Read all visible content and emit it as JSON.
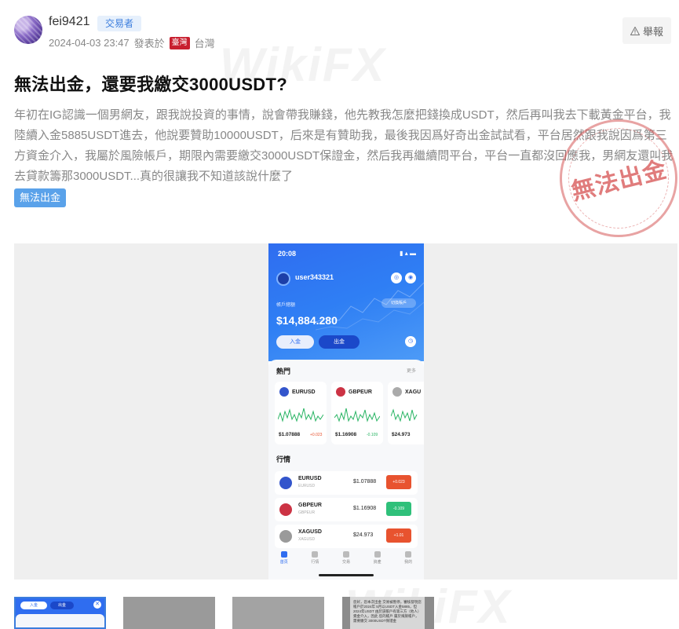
{
  "author": {
    "username": "fei9421",
    "role": "交易者",
    "datetime": "2024-04-03 23:47",
    "posted_in": "發表於",
    "flag_label": "臺灣",
    "region": "台灣"
  },
  "report": {
    "label": "舉報",
    "icon": "warning-icon"
  },
  "post": {
    "title": "無法出金，還要我繳交3000USDT?",
    "body": "年初在IG認識一個男網友，跟我說投資的事情，說會帶我賺錢，他先教我怎麼把錢換成USDT，然后再叫我去下載黃金平台，我陸續入金5885USDT進去，他說要贊助10000USDT，后來是有贊助我，最後我因爲好奇出金試試看，平台居然跟我說因爲第三方資金介入，我屬於風險帳戶，期限內需要繳交3000USDT保證金，然后我再繼續問平台，平台一直都沒回應我，男網友還叫我去貸款籌那3000USDT...真的很讓我不知道該說什麼了",
    "tag": "無法出金",
    "stamp": "無法出金",
    "watermark": "WikiFX"
  },
  "phone": {
    "time": "20:08",
    "status_icons": "▮ ▴ ▬",
    "user": "user343321",
    "account_label": "帳戶總額",
    "switch_label": "切換賬戶",
    "balance": "$14,884.280",
    "deposit_label": "入金",
    "withdraw_label": "出金",
    "hot_title": "熱門",
    "more_label": "更多",
    "hot_cards": [
      {
        "symbol": "EURUSD",
        "price": "$1.07888",
        "change": "+0.023",
        "color": "#28b463",
        "coin": "#3355cc"
      },
      {
        "symbol": "GBPEUR",
        "price": "$1.16908",
        "change": "-0.109",
        "color": "#28b463",
        "coin": "#cc3344"
      },
      {
        "symbol": "XAGU",
        "price": "$24.973",
        "change": "",
        "color": "#28b463",
        "coin": "#aaaaaa"
      }
    ],
    "market_title": "行情",
    "rows": [
      {
        "symbol": "EURUSD",
        "sub": "EURUSD",
        "price": "$1.07888",
        "change": "+0.023",
        "color": "#e8532f",
        "coin": "#3355cc"
      },
      {
        "symbol": "GBPEUR",
        "sub": "GBPEUR",
        "price": "$1.16908",
        "change": "-0.109",
        "color": "#2fc07a",
        "coin": "#cc3344"
      },
      {
        "symbol": "XAGUSD",
        "sub": "XAGUSD",
        "price": "$24.973",
        "change": "+1.01",
        "color": "#e8532f",
        "coin": "#9a9a9a"
      }
    ],
    "nav": [
      "首頁",
      "行情",
      "交易",
      "資產",
      "我的"
    ]
  },
  "thumbnails": {
    "thumb1": {
      "btn1": "入金",
      "btn2": "出金",
      "close": "✕"
    },
    "thumb4_text": "您好，您本次出金 交易被暫停，審核發現您帳戶於2024年 5月以USDT入金5885，但 2024年USDT 由於該帳戶有第三方（他人） 資金介入，因此 您的帳戶 屬於風險帳戶，需要繳交 3000USDT保證金"
  }
}
